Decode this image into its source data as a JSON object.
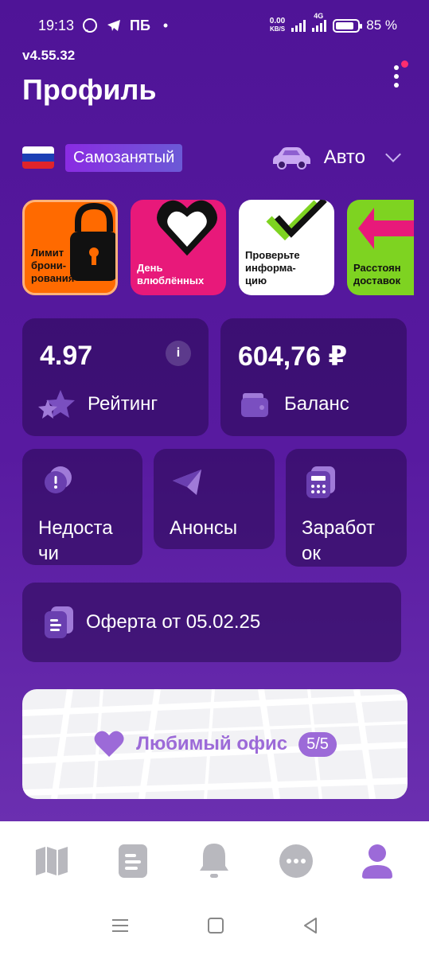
{
  "status_bar": {
    "time": "19:13",
    "notif_text": "ПБ",
    "dot": "•",
    "net_speed_value": "0.00",
    "net_speed_unit": "KB/S",
    "network_label": "4G",
    "battery_percent": "85 %",
    "battery_level": 0.85
  },
  "header": {
    "version": "v4.55.32",
    "title": "Профиль"
  },
  "employment": {
    "status": "Самозанятый",
    "vehicle": "Авто"
  },
  "stories": [
    {
      "label": "Лимит\nброни-\nрования",
      "color": "#ff6a00"
    },
    {
      "label": "День\nвлюблённых",
      "color": "#e8197a"
    },
    {
      "label": "Проверьте\nинформа-\nцию",
      "color": "#ffffff"
    },
    {
      "label": "Расстоян\nдоставок",
      "color": "#7ed321"
    }
  ],
  "rating": {
    "value": "4.97",
    "label": "Рейтинг",
    "info": "i"
  },
  "balance": {
    "value": "604,76 ₽",
    "label": "Баланс"
  },
  "shortcuts": [
    {
      "label": "Недоста\nчи"
    },
    {
      "label": "Анонсы"
    },
    {
      "label": "Заработ\nок"
    }
  ],
  "offer": {
    "label": "Оферта от 05.02.25"
  },
  "favorite_office": {
    "label": "Любимый офис",
    "count": "5/5"
  },
  "colors": {
    "accent": "#9c6ad8",
    "background": "#4f1497",
    "nav_active": "#9c6ad8",
    "nav_inactive": "#b8b8be"
  },
  "bottom_nav": [
    "map-icon",
    "document-icon",
    "bell-icon",
    "chat-icon",
    "profile-icon"
  ]
}
